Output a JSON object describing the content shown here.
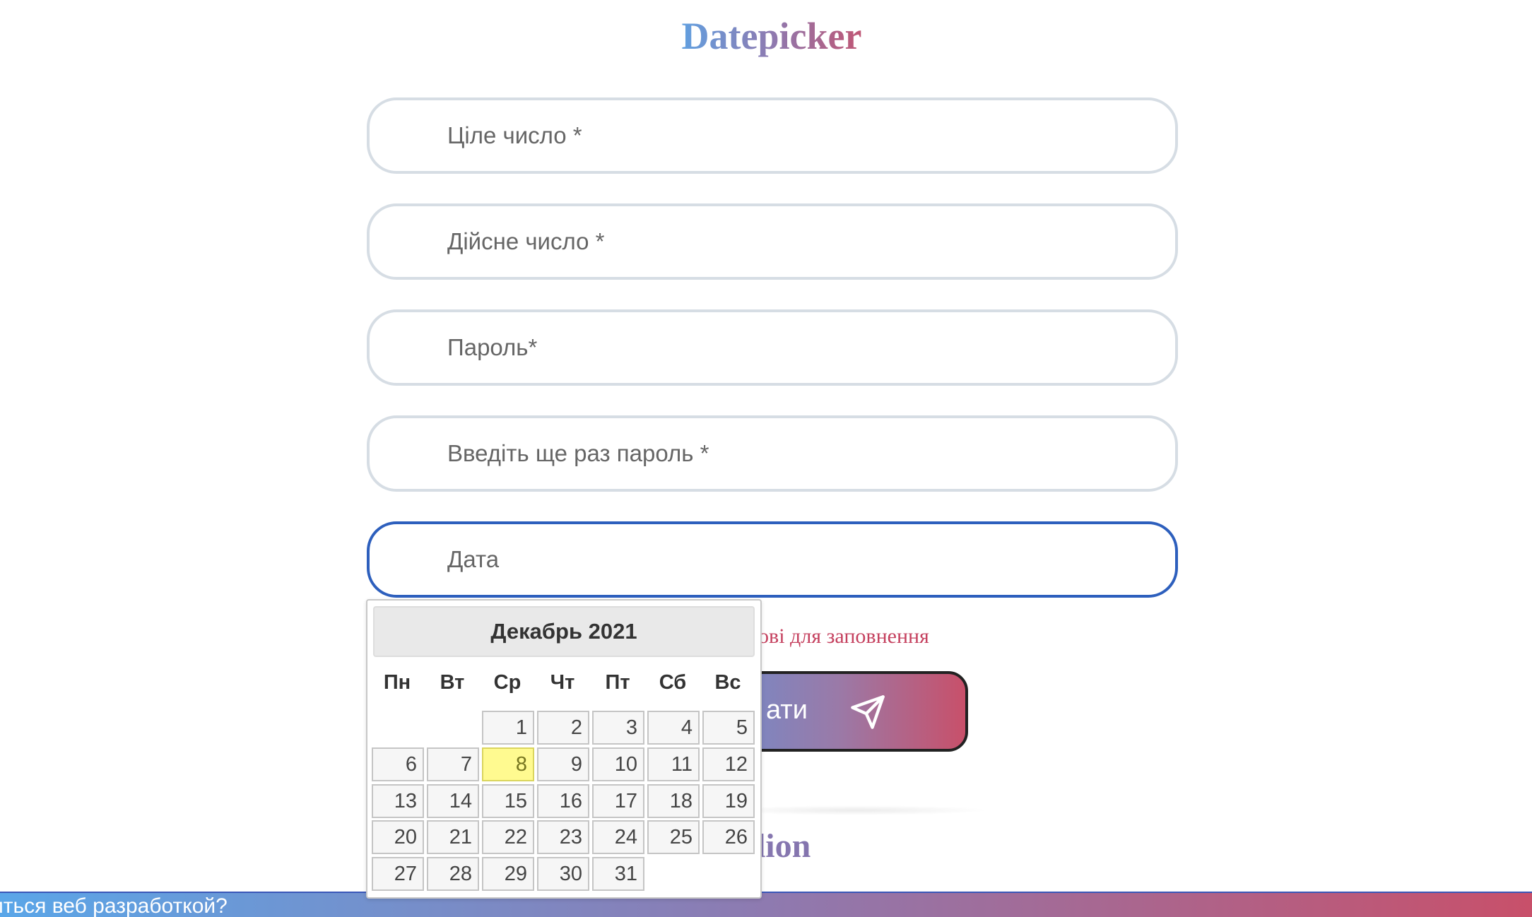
{
  "heading": "Datepicker",
  "form": {
    "integer_placeholder": "Ціле число *",
    "real_placeholder": "Дійсне число *",
    "password_placeholder": "Пароль*",
    "password_repeat_placeholder": "Введіть ще раз пароль *",
    "date_placeholder": "Дата",
    "required_note": "кові для заповнення",
    "submit_label": "ати"
  },
  "calendar": {
    "month_year": "Декабрь 2021",
    "weekdays": [
      "Пн",
      "Вт",
      "Ср",
      "Чт",
      "Пт",
      "Сб",
      "Вс"
    ],
    "today": 8,
    "weeks": [
      [
        "",
        "",
        "1",
        "2",
        "3",
        "4",
        "5"
      ],
      [
        "6",
        "7",
        "8",
        "9",
        "10",
        "11",
        "12"
      ],
      [
        "13",
        "14",
        "15",
        "16",
        "17",
        "18",
        "19"
      ],
      [
        "20",
        "21",
        "22",
        "23",
        "24",
        "25",
        "26"
      ],
      [
        "27",
        "28",
        "29",
        "30",
        "31",
        "",
        ""
      ]
    ]
  },
  "accordion_heading": "cordion",
  "bottom_banner": "иться веб разработкой?",
  "colors": {
    "focus_border": "#2d5fbd",
    "today_highlight": "#fffa90",
    "error_text": "#c5415f"
  }
}
